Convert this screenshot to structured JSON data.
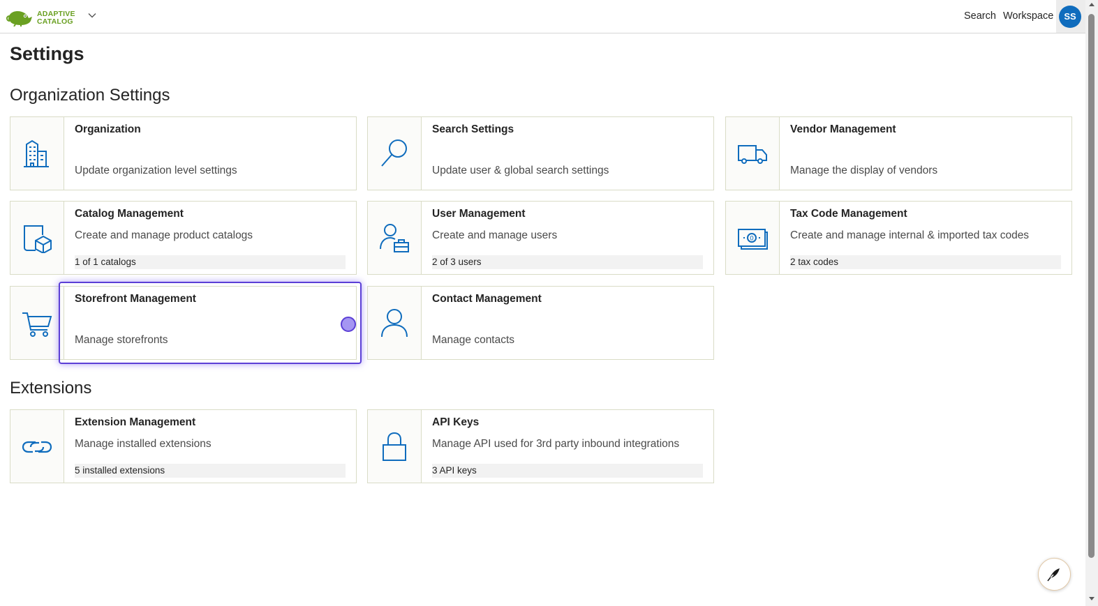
{
  "header": {
    "logo_line1": "ADAPTIVE",
    "logo_line2": "CATALOG",
    "search_label": "Search",
    "workspace_label": "Workspace",
    "avatar_initials": "SS"
  },
  "page": {
    "title": "Settings"
  },
  "org_section": {
    "title": "Organization Settings",
    "cards": [
      {
        "title": "Organization",
        "description": "Update organization level settings",
        "icon": "building-icon"
      },
      {
        "title": "Search Settings",
        "description": "Update user & global search settings",
        "icon": "magnifier-icon"
      },
      {
        "title": "Vendor Management",
        "description": "Manage the display of vendors",
        "icon": "truck-icon"
      },
      {
        "title": "Catalog Management",
        "description": "Create and manage product catalogs",
        "badge": "1 of 1 catalogs",
        "icon": "catalog-box-icon"
      },
      {
        "title": "User Management",
        "description": "Create and manage users",
        "badge": "2 of 3 users",
        "icon": "user-briefcase-icon"
      },
      {
        "title": "Tax Code Management",
        "description": "Create and manage internal & imported tax codes",
        "badge": "2 tax codes",
        "icon": "money-icon"
      },
      {
        "title": "Storefront Management",
        "description": "Manage storefronts",
        "icon": "cart-icon"
      },
      {
        "title": "Contact Management",
        "description": "Manage contacts",
        "icon": "person-icon"
      }
    ]
  },
  "extensions_section": {
    "title": "Extensions",
    "cards": [
      {
        "title": "Extension Management",
        "description": "Manage installed extensions",
        "badge": "5 installed extensions",
        "icon": "link-icon"
      },
      {
        "title": "API Keys",
        "description": "Manage API used for 3rd party inbound integrations",
        "badge": "3 API keys",
        "icon": "lock-icon"
      }
    ]
  },
  "colors": {
    "accent": "#0f6cbd",
    "brand_green": "#6aa022",
    "highlight": "#5b3fd6",
    "card_border": "#d9dcc6"
  }
}
